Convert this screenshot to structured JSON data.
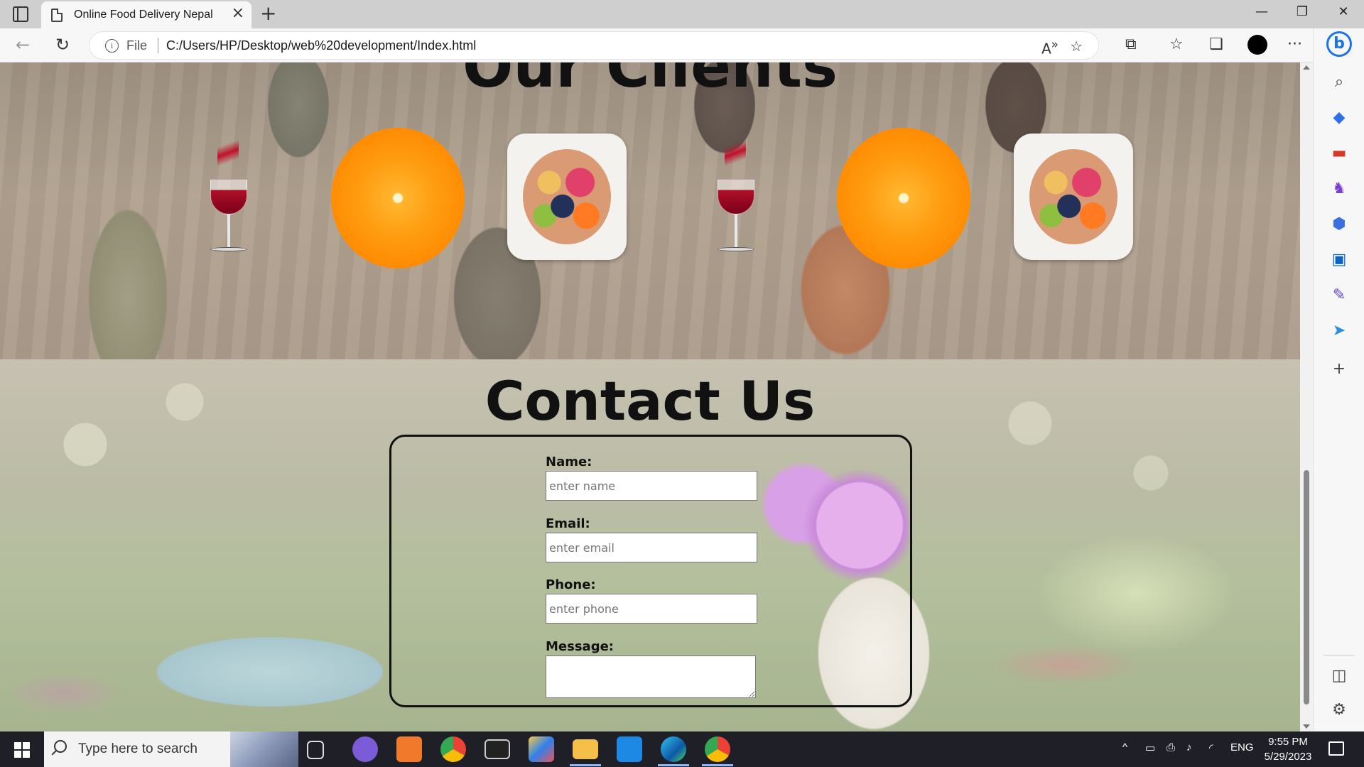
{
  "browser": {
    "tab_title": "Online Food Delivery Nepal",
    "tab_close": "×",
    "new_tab": "+",
    "scheme_label": "File",
    "url": "C:/Users/HP/Desktop/web%20development/Index.html",
    "win_controls": {
      "minimize": "—",
      "maximize": "❐",
      "close": "✕"
    },
    "nav": {
      "back": "←",
      "refresh": "↻",
      "more": "···"
    }
  },
  "page": {
    "clients_heading": "Our Clients",
    "contact_heading": "Contact Us",
    "form": {
      "name_label": "Name:",
      "name_placeholder": "enter name",
      "email_label": "Email:",
      "email_placeholder": "enter email",
      "phone_label": "Phone:",
      "phone_placeholder": "enter phone",
      "message_label": "Message:"
    }
  },
  "sidebar_icons": [
    "search-icon",
    "tag-icon",
    "toolbox-icon",
    "chess-icon",
    "office-icon",
    "outlook-icon",
    "designer-icon",
    "send-icon",
    "add-icon",
    "split-screen-icon",
    "settings-icon"
  ],
  "taskbar": {
    "search_placeholder": "Type here to search",
    "language": "ENG",
    "time": "9:55 PM",
    "date": "5/29/2023",
    "apps": [
      "task-view",
      "viber",
      "xampp",
      "chrome",
      "terminal",
      "app-cube",
      "file-explorer",
      "vscode",
      "edge",
      "chrome-profile"
    ]
  },
  "colors": {
    "accent": "#1a73e8",
    "taskbar": "#1f1f28",
    "tab_bar": "#cfcfcf"
  }
}
